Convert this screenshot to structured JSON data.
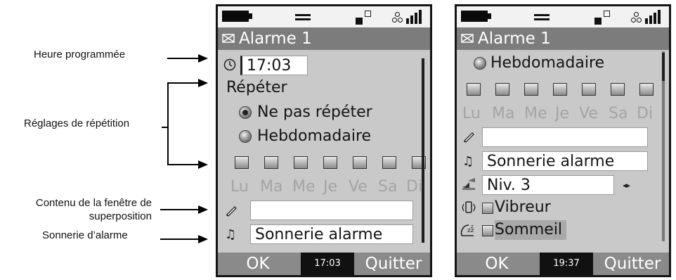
{
  "callouts": {
    "heure": "Heure programmée",
    "repetition": "Réglages de répétition",
    "contenu_line1": "Contenu de la fenêtre de",
    "contenu_line2": "superposition",
    "sonnerie": "Sonnerie d’alarme"
  },
  "screen1": {
    "title": "Alarme 1",
    "time_value": "17:03",
    "repeat_label": "Répéter",
    "option_no_repeat": "Ne pas répéter",
    "option_weekly": "Hebdomadaire",
    "days": [
      "Lu",
      "Ma",
      "Me",
      "Je",
      "Ve",
      "Sa",
      "Di"
    ],
    "popup_text": "",
    "ringtone": "Sonnerie alarme",
    "soft_left": "OK",
    "clock": "17:03",
    "soft_right": "Quitter"
  },
  "screen2": {
    "title": "Alarme 1",
    "option_weekly": "Hebdomadaire",
    "days": [
      "Lu",
      "Ma",
      "Me",
      "Je",
      "Ve",
      "Sa",
      "Di"
    ],
    "popup_text": "",
    "ringtone": "Sonnerie alarme",
    "volume": "Niv. 3",
    "vibrate": "Vibreur",
    "snooze": "Sommeil",
    "soft_left": "OK",
    "clock": "19:37",
    "soft_right": "Quitter"
  }
}
